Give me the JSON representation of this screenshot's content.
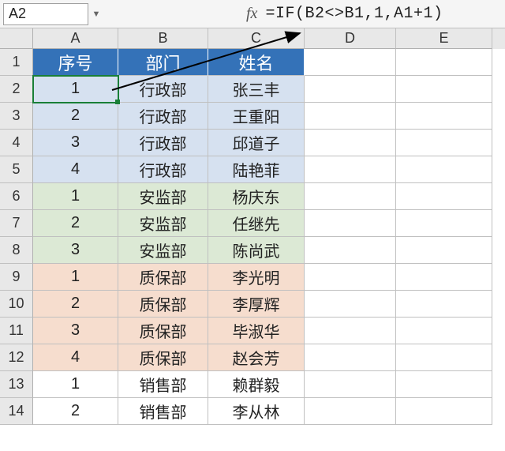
{
  "name_box": "A2",
  "fx_label": "fx",
  "formula": "=IF(B2<>B1,1,A1+1)",
  "columns": [
    "A",
    "B",
    "C",
    "D",
    "E"
  ],
  "row_numbers": [
    1,
    2,
    3,
    4,
    5,
    6,
    7,
    8,
    9,
    10,
    11,
    12,
    13,
    14
  ],
  "header_row": {
    "a": "序号",
    "b": "部门",
    "c": "姓名"
  },
  "rows": [
    {
      "seq": "1",
      "dept": "行政部",
      "name": "张三丰",
      "group": "blue",
      "selected": true
    },
    {
      "seq": "2",
      "dept": "行政部",
      "name": "王重阳",
      "group": "blue"
    },
    {
      "seq": "3",
      "dept": "行政部",
      "name": "邱道子",
      "group": "blue"
    },
    {
      "seq": "4",
      "dept": "行政部",
      "name": "陆艳菲",
      "group": "blue"
    },
    {
      "seq": "1",
      "dept": "安监部",
      "name": "杨庆东",
      "group": "green"
    },
    {
      "seq": "2",
      "dept": "安监部",
      "name": "任继先",
      "group": "green"
    },
    {
      "seq": "3",
      "dept": "安监部",
      "name": "陈尚武",
      "group": "green"
    },
    {
      "seq": "1",
      "dept": "质保部",
      "name": "李光明",
      "group": "orange"
    },
    {
      "seq": "2",
      "dept": "质保部",
      "name": "李厚辉",
      "group": "orange"
    },
    {
      "seq": "3",
      "dept": "质保部",
      "name": "毕淑华",
      "group": "orange"
    },
    {
      "seq": "4",
      "dept": "质保部",
      "name": "赵会芳",
      "group": "orange"
    },
    {
      "seq": "1",
      "dept": "销售部",
      "name": "赖群毅",
      "group": "plain"
    },
    {
      "seq": "2",
      "dept": "销售部",
      "name": "李从林",
      "group": "plain"
    }
  ],
  "chart_data": {
    "type": "table",
    "title": "",
    "columns": [
      "序号",
      "部门",
      "姓名"
    ],
    "data": [
      [
        1,
        "行政部",
        "张三丰"
      ],
      [
        2,
        "行政部",
        "王重阳"
      ],
      [
        3,
        "行政部",
        "邱道子"
      ],
      [
        4,
        "行政部",
        "陆艳菲"
      ],
      [
        1,
        "安监部",
        "杨庆东"
      ],
      [
        2,
        "安监部",
        "任继先"
      ],
      [
        3,
        "安监部",
        "陈尚武"
      ],
      [
        1,
        "质保部",
        "李光明"
      ],
      [
        2,
        "质保部",
        "李厚辉"
      ],
      [
        3,
        "质保部",
        "毕淑华"
      ],
      [
        4,
        "质保部",
        "赵会芳"
      ],
      [
        1,
        "销售部",
        "赖群毅"
      ],
      [
        2,
        "销售部",
        "李从林"
      ]
    ]
  }
}
